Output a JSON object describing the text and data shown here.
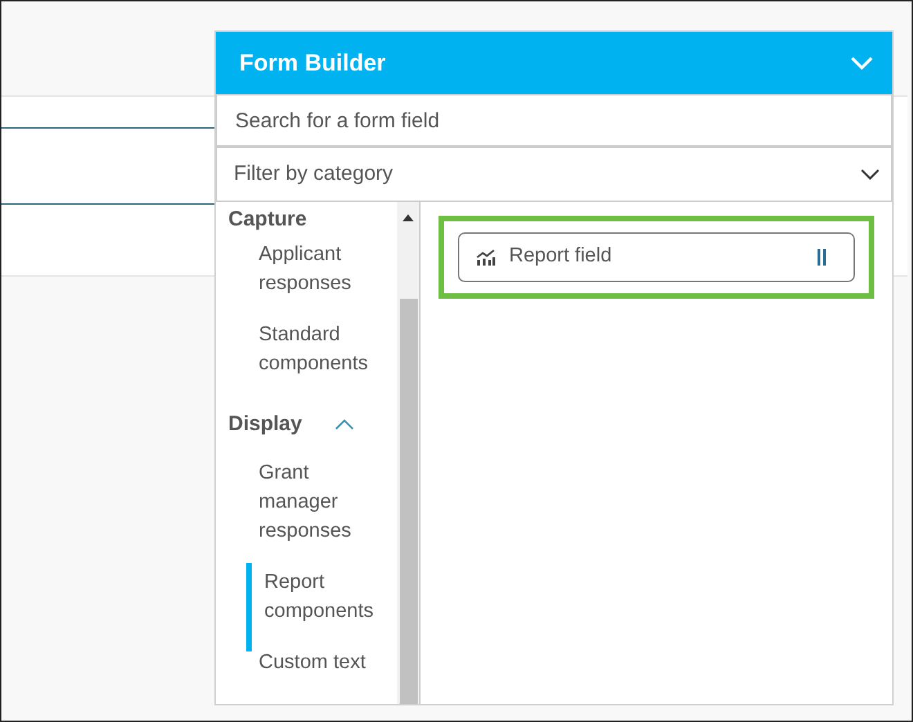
{
  "panel": {
    "title": "Form Builder",
    "expanded": true
  },
  "search": {
    "placeholder": "Search for a form field"
  },
  "filter": {
    "placeholder": "Filter by category"
  },
  "categories": [
    {
      "label": "Capture",
      "children": [
        {
          "label": "Applicant responses",
          "selected": false
        },
        {
          "label": "Standard components",
          "selected": false
        }
      ]
    },
    {
      "label": "Display",
      "expanded": true,
      "children": [
        {
          "label": "Grant manager responses",
          "selected": false
        },
        {
          "label": "Report components",
          "selected": true
        },
        {
          "label": "Custom text",
          "selected": false
        }
      ]
    }
  ],
  "fields": [
    {
      "label": "Report field",
      "highlighted": true
    }
  ]
}
